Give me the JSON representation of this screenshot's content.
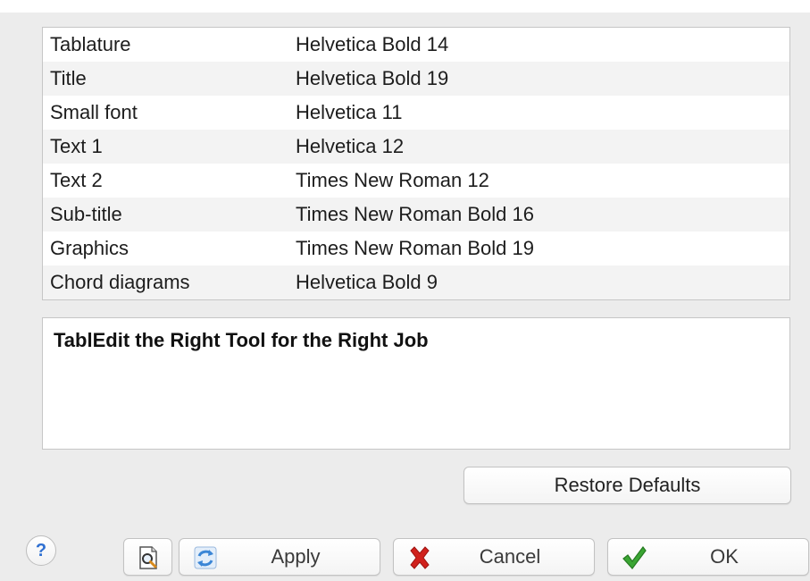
{
  "font_table": {
    "rows": [
      {
        "name": "Tablature",
        "font": "Helvetica Bold 14"
      },
      {
        "name": "Title",
        "font": "Helvetica Bold 19"
      },
      {
        "name": "Small font",
        "font": "Helvetica 11"
      },
      {
        "name": "Text 1",
        "font": "Helvetica 12"
      },
      {
        "name": "Text 2",
        "font": "Times New Roman 12"
      },
      {
        "name": "Sub-title",
        "font": "Times New Roman Bold 16"
      },
      {
        "name": "Graphics",
        "font": "Times New Roman Bold 19"
      },
      {
        "name": "Chord diagrams",
        "font": "Helvetica Bold 9"
      }
    ]
  },
  "preview": {
    "text": "TablEdit the Right Tool for the Right Job"
  },
  "buttons": {
    "restore_defaults": "Restore Defaults",
    "help": "?",
    "preview_icon": "page-magnifier-icon",
    "apply": "Apply",
    "apply_icon": "refresh-arrows-icon",
    "cancel": "Cancel",
    "cancel_icon": "red-x-icon",
    "ok": "OK",
    "ok_icon": "green-check-icon"
  },
  "colors": {
    "window_bg": "#ececec",
    "panel_bg": "#ffffff",
    "alt_row": "#f3f3f3",
    "cancel_red": "#d0211c",
    "ok_green": "#3aa533",
    "apply_blue": "#3b86d6",
    "help_blue": "#2e6fd1"
  }
}
